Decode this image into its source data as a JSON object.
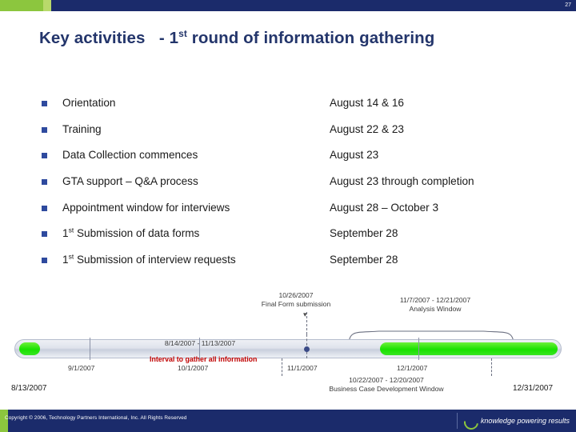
{
  "page": {
    "number": "27",
    "title_main": "Key activities",
    "title_rest_pre": "- 1",
    "title_rest_sup": "st",
    "title_rest_post": " round of information gathering"
  },
  "activities": [
    {
      "label": "Orientation",
      "value": "August 14 & 16"
    },
    {
      "label": "Training",
      "value": "August 22 & 23"
    },
    {
      "label": "Data Collection commences",
      "value": "August 23"
    },
    {
      "label": "GTA support – Q&A process",
      "value": "August 23 through completion"
    },
    {
      "label": "Appointment window for interviews",
      "value": "August 28 – October 3"
    },
    {
      "label_pre": "1",
      "label_sup": "st",
      "label_post": " Submission of data forms",
      "value": "September 28"
    },
    {
      "label_pre": "1",
      "label_sup": "st",
      "label_post": " Submission of interview requests",
      "value": "September 28"
    }
  ],
  "timeline": {
    "start_date": "8/13/2007",
    "end_date": "12/31/2007",
    "ticks": [
      "9/1/2007",
      "10/1/2007",
      "11/1/2007",
      "12/1/2007"
    ],
    "callout_top_left": {
      "date": "10/26/2007",
      "label": "Final Form submission"
    },
    "callout_top_right": {
      "date": "11/7/2007 - 12/21/2007",
      "label": "Analysis Window"
    },
    "callout_bottom": {
      "date": "10/22/2007 - 12/20/2007",
      "label": "Business Case Development Window"
    },
    "interval_band": {
      "date": "8/14/2007 - 11/13/2007",
      "label": "Interval to gather all information"
    }
  },
  "footer": {
    "copyright": "Copyright © 2006, Technology Partners International, Inc.  All Rights Reserved",
    "logo_text": "knowledge powering results"
  }
}
